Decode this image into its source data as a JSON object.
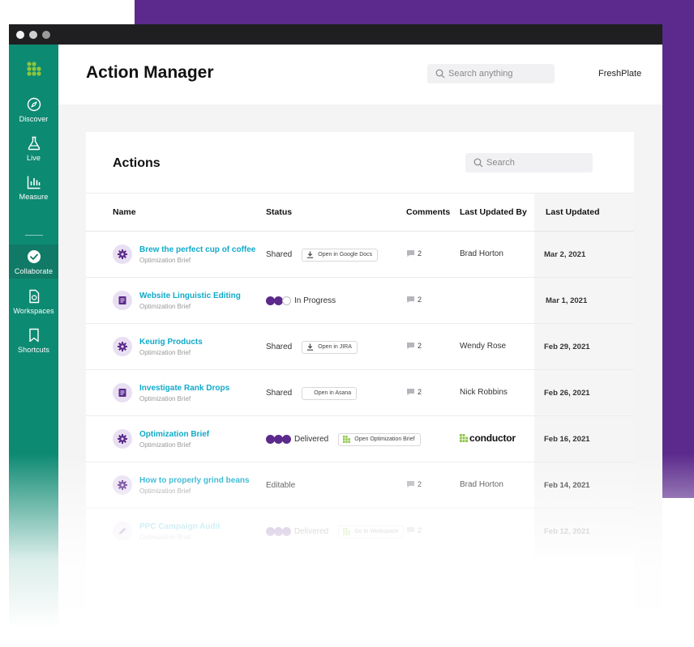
{
  "app": {
    "title": "Action Manager",
    "brand": "FreshPlate"
  },
  "search": {
    "placeholder": "Search anything"
  },
  "sidebar": {
    "items": [
      {
        "label": "Discover",
        "icon": "compass-icon",
        "active": false
      },
      {
        "label": "Live",
        "icon": "flask-icon",
        "active": false
      },
      {
        "label": "Measure",
        "icon": "bar-chart-icon",
        "active": false
      },
      {
        "label": "Collaborate",
        "icon": "check-circle-icon",
        "active": true
      },
      {
        "label": "Workspaces",
        "icon": "document-icon",
        "active": false
      },
      {
        "label": "Shortcuts",
        "icon": "bookmark-icon",
        "active": false
      }
    ]
  },
  "actions": {
    "title": "Actions",
    "search_placeholder": "Search",
    "columns": [
      "Name",
      "Status",
      "Comments",
      "Last Updated By",
      "Last Updated"
    ],
    "rows": [
      {
        "title": "Brew the perfect cup of coffee",
        "subtitle": "Optimization Brief",
        "type_icon": "gear-icon",
        "status": "Shared",
        "action": "Open in Google Docs",
        "action_icon": "download-icon",
        "comments": "2",
        "user": "Brad Horton",
        "date": "Mar 2, 2021"
      },
      {
        "title": "Website Linguistic Editing",
        "subtitle": "Optimization Brief",
        "type_icon": "document-icon",
        "status": "In Progress",
        "progress": 2,
        "comments": "2",
        "user": "",
        "date": "Mar 1, 2021"
      },
      {
        "title": "Keurig Products",
        "subtitle": "Optimization Brief",
        "type_icon": "gear-icon",
        "status": "Shared",
        "action": "Open in JIRA",
        "action_icon": "download-icon",
        "comments": "2",
        "user": "Wendy Rose",
        "date": "Feb 29, 2021"
      },
      {
        "title": "Investigate Rank Drops",
        "subtitle": "Optimization Brief",
        "type_icon": "document-icon",
        "status": "Shared",
        "action": "Open in Asana",
        "comments": "2",
        "user": "Nick Robbins",
        "date": "Feb 26, 2021"
      },
      {
        "title": "Optimization Brief",
        "subtitle": "Optimization Brief",
        "type_icon": "gear-icon",
        "status": "Delivered",
        "progress": 3,
        "action": "Open Optimization Brief",
        "action_icon": "conductor-logo-icon",
        "user": "conductor",
        "user_is_logo": true,
        "date": "Feb 16, 2021"
      },
      {
        "title": "How to properly grind beans",
        "subtitle": "Optimization Brief",
        "type_icon": "gear-icon",
        "status": "Editable",
        "comments": "2",
        "user": "Brad Horton",
        "date": "Feb 14, 2021"
      },
      {
        "title": "PPC Campaign Audit",
        "subtitle": "Optimization Brief",
        "type_icon": "pencil-icon",
        "status": "Delivered",
        "progress": 3,
        "action": "Go to Workspace",
        "action_icon": "conductor-logo-icon",
        "comments": "2",
        "user": "",
        "date": "Feb 12, 2021",
        "faded": true
      }
    ]
  },
  "colors": {
    "sidebar": "#0d8a72",
    "accent_purple": "#5b2a8c",
    "link": "#10aac9",
    "logo_green": "#8bc53f"
  }
}
